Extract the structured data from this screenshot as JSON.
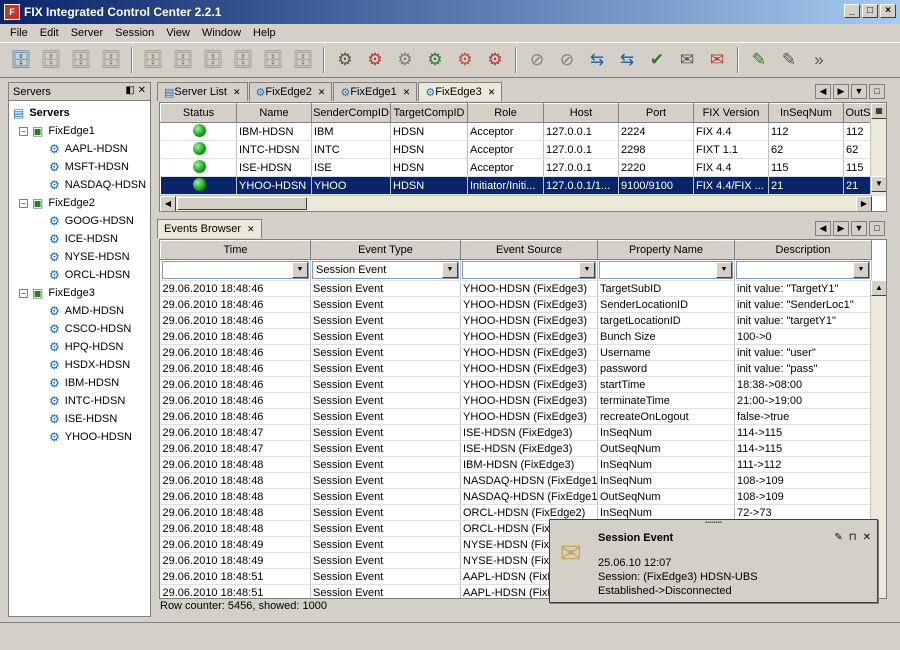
{
  "window": {
    "title": "FIX Integrated Control Center 2.2.1"
  },
  "menu": [
    "File",
    "Edit",
    "Server",
    "Session",
    "View",
    "Window",
    "Help"
  ],
  "left_panel": {
    "title": "Servers",
    "root": "Servers",
    "groups": [
      {
        "name": "FixEdge1",
        "sessions": [
          "AAPL-HDSN",
          "MSFT-HDSN",
          "NASDAQ-HDSN"
        ]
      },
      {
        "name": "FixEdge2",
        "sessions": [
          "GOOG-HDSN",
          "ICE-HDSN",
          "NYSE-HDSN",
          "ORCL-HDSN"
        ]
      },
      {
        "name": "FixEdge3",
        "sessions": [
          "AMD-HDSN",
          "CSCO-HDSN",
          "HPQ-HDSN",
          "HSDX-HDSN",
          "IBM-HDSN",
          "INTC-HDSN",
          "ISE-HDSN",
          "YHOO-HDSN"
        ]
      }
    ]
  },
  "tabs": [
    "Server List",
    "FixEdge2",
    "FixEdge1",
    "FixEdge3"
  ],
  "server_table": {
    "headers": [
      "Status",
      "Name",
      "SenderCompID",
      "TargetCompID",
      "Role",
      "Host",
      "Port",
      "FIX Version",
      "InSeqNum",
      "OutS"
    ],
    "rows": [
      [
        "",
        "IBM-HDSN",
        "IBM",
        "HDSN",
        "Acceptor",
        "127.0.0.1",
        "2224",
        "FIX 4.4",
        "112",
        "112"
      ],
      [
        "",
        "INTC-HDSN",
        "INTC",
        "HDSN",
        "Acceptor",
        "127.0.0.1",
        "2298",
        "FIXT 1.1",
        "62",
        "62"
      ],
      [
        "",
        "ISE-HDSN",
        "ISE",
        "HDSN",
        "Acceptor",
        "127.0.0.1",
        "2220",
        "FIX 4.4",
        "115",
        "115"
      ],
      [
        "",
        "YHOO-HDSN",
        "YHOO",
        "HDSN",
        "Initiator/Initi...",
        "127.0.0.1/1...",
        "9100/9100",
        "FIX 4.4/FIX ...",
        "21",
        "21"
      ]
    ]
  },
  "events": {
    "tab": "Events Browser",
    "headers": [
      "Time",
      "Event Type",
      "Event Source",
      "Property Name",
      "Description"
    ],
    "filter_event_type": "Session Event",
    "rows": [
      [
        "29.06.2010 18:48:46",
        "Session Event",
        "YHOO-HDSN (FixEdge3)",
        "TargetSubID",
        "init value: \"TargetY1\""
      ],
      [
        "29.06.2010 18:48:46",
        "Session Event",
        "YHOO-HDSN (FixEdge3)",
        "SenderLocationID",
        "init value: \"SenderLoc1\""
      ],
      [
        "29.06.2010 18:48:46",
        "Session Event",
        "YHOO-HDSN (FixEdge3)",
        "targetLocationID",
        "init value: \"targetY1\""
      ],
      [
        "29.06.2010 18:48:46",
        "Session Event",
        "YHOO-HDSN (FixEdge3)",
        "Bunch Size",
        "100->0"
      ],
      [
        "29.06.2010 18:48:46",
        "Session Event",
        "YHOO-HDSN (FixEdge3)",
        "Username",
        "init value: \"user\""
      ],
      [
        "29.06.2010 18:48:46",
        "Session Event",
        "YHOO-HDSN (FixEdge3)",
        "password",
        "init value: \"pass\""
      ],
      [
        "29.06.2010 18:48:46",
        "Session Event",
        "YHOO-HDSN (FixEdge3)",
        "startTime",
        "18:38->08:00"
      ],
      [
        "29.06.2010 18:48:46",
        "Session Event",
        "YHOO-HDSN (FixEdge3)",
        "terminateTime",
        "21:00->19:00"
      ],
      [
        "29.06.2010 18:48:46",
        "Session Event",
        "YHOO-HDSN (FixEdge3)",
        "recreateOnLogout",
        "false->true"
      ],
      [
        "29.06.2010 18:48:47",
        "Session Event",
        "ISE-HDSN (FixEdge3)",
        "InSeqNum",
        "114->115"
      ],
      [
        "29.06.2010 18:48:47",
        "Session Event",
        "ISE-HDSN (FixEdge3)",
        "OutSeqNum",
        "114->115"
      ],
      [
        "29.06.2010 18:48:48",
        "Session Event",
        "IBM-HDSN (FixEdge3)",
        "InSeqNum",
        "111->112"
      ],
      [
        "29.06.2010 18:48:48",
        "Session Event",
        "NASDAQ-HDSN (FixEdge1)",
        "InSeqNum",
        "108->109"
      ],
      [
        "29.06.2010 18:48:48",
        "Session Event",
        "NASDAQ-HDSN (FixEdge1)",
        "OutSeqNum",
        "108->109"
      ],
      [
        "29.06.2010 18:48:48",
        "Session Event",
        "ORCL-HDSN (FixEdge2)",
        "InSeqNum",
        "72->73"
      ],
      [
        "29.06.2010 18:48:48",
        "Session Event",
        "ORCL-HDSN (FixEd",
        "",
        ""
      ],
      [
        "29.06.2010 18:48:49",
        "Session Event",
        "NYSE-HDSN (FixEd",
        "",
        ""
      ],
      [
        "29.06.2010 18:48:49",
        "Session Event",
        "NYSE-HDSN (FixEd",
        "",
        ""
      ],
      [
        "29.06.2010 18:48:51",
        "Session Event",
        "AAPL-HDSN (FixEd",
        "",
        ""
      ],
      [
        "29.06.2010 18:48:51",
        "Session Event",
        "AAPL-HDSN (FixEd",
        "",
        ""
      ]
    ],
    "row_counter": "Row counter: 5456, showed: 1000"
  },
  "popup": {
    "title": "Session Event",
    "date": "25.06.10 12:07",
    "session": "Session: (FixEdge3) HDSN-UBS",
    "message": "Established->Disconnected"
  }
}
